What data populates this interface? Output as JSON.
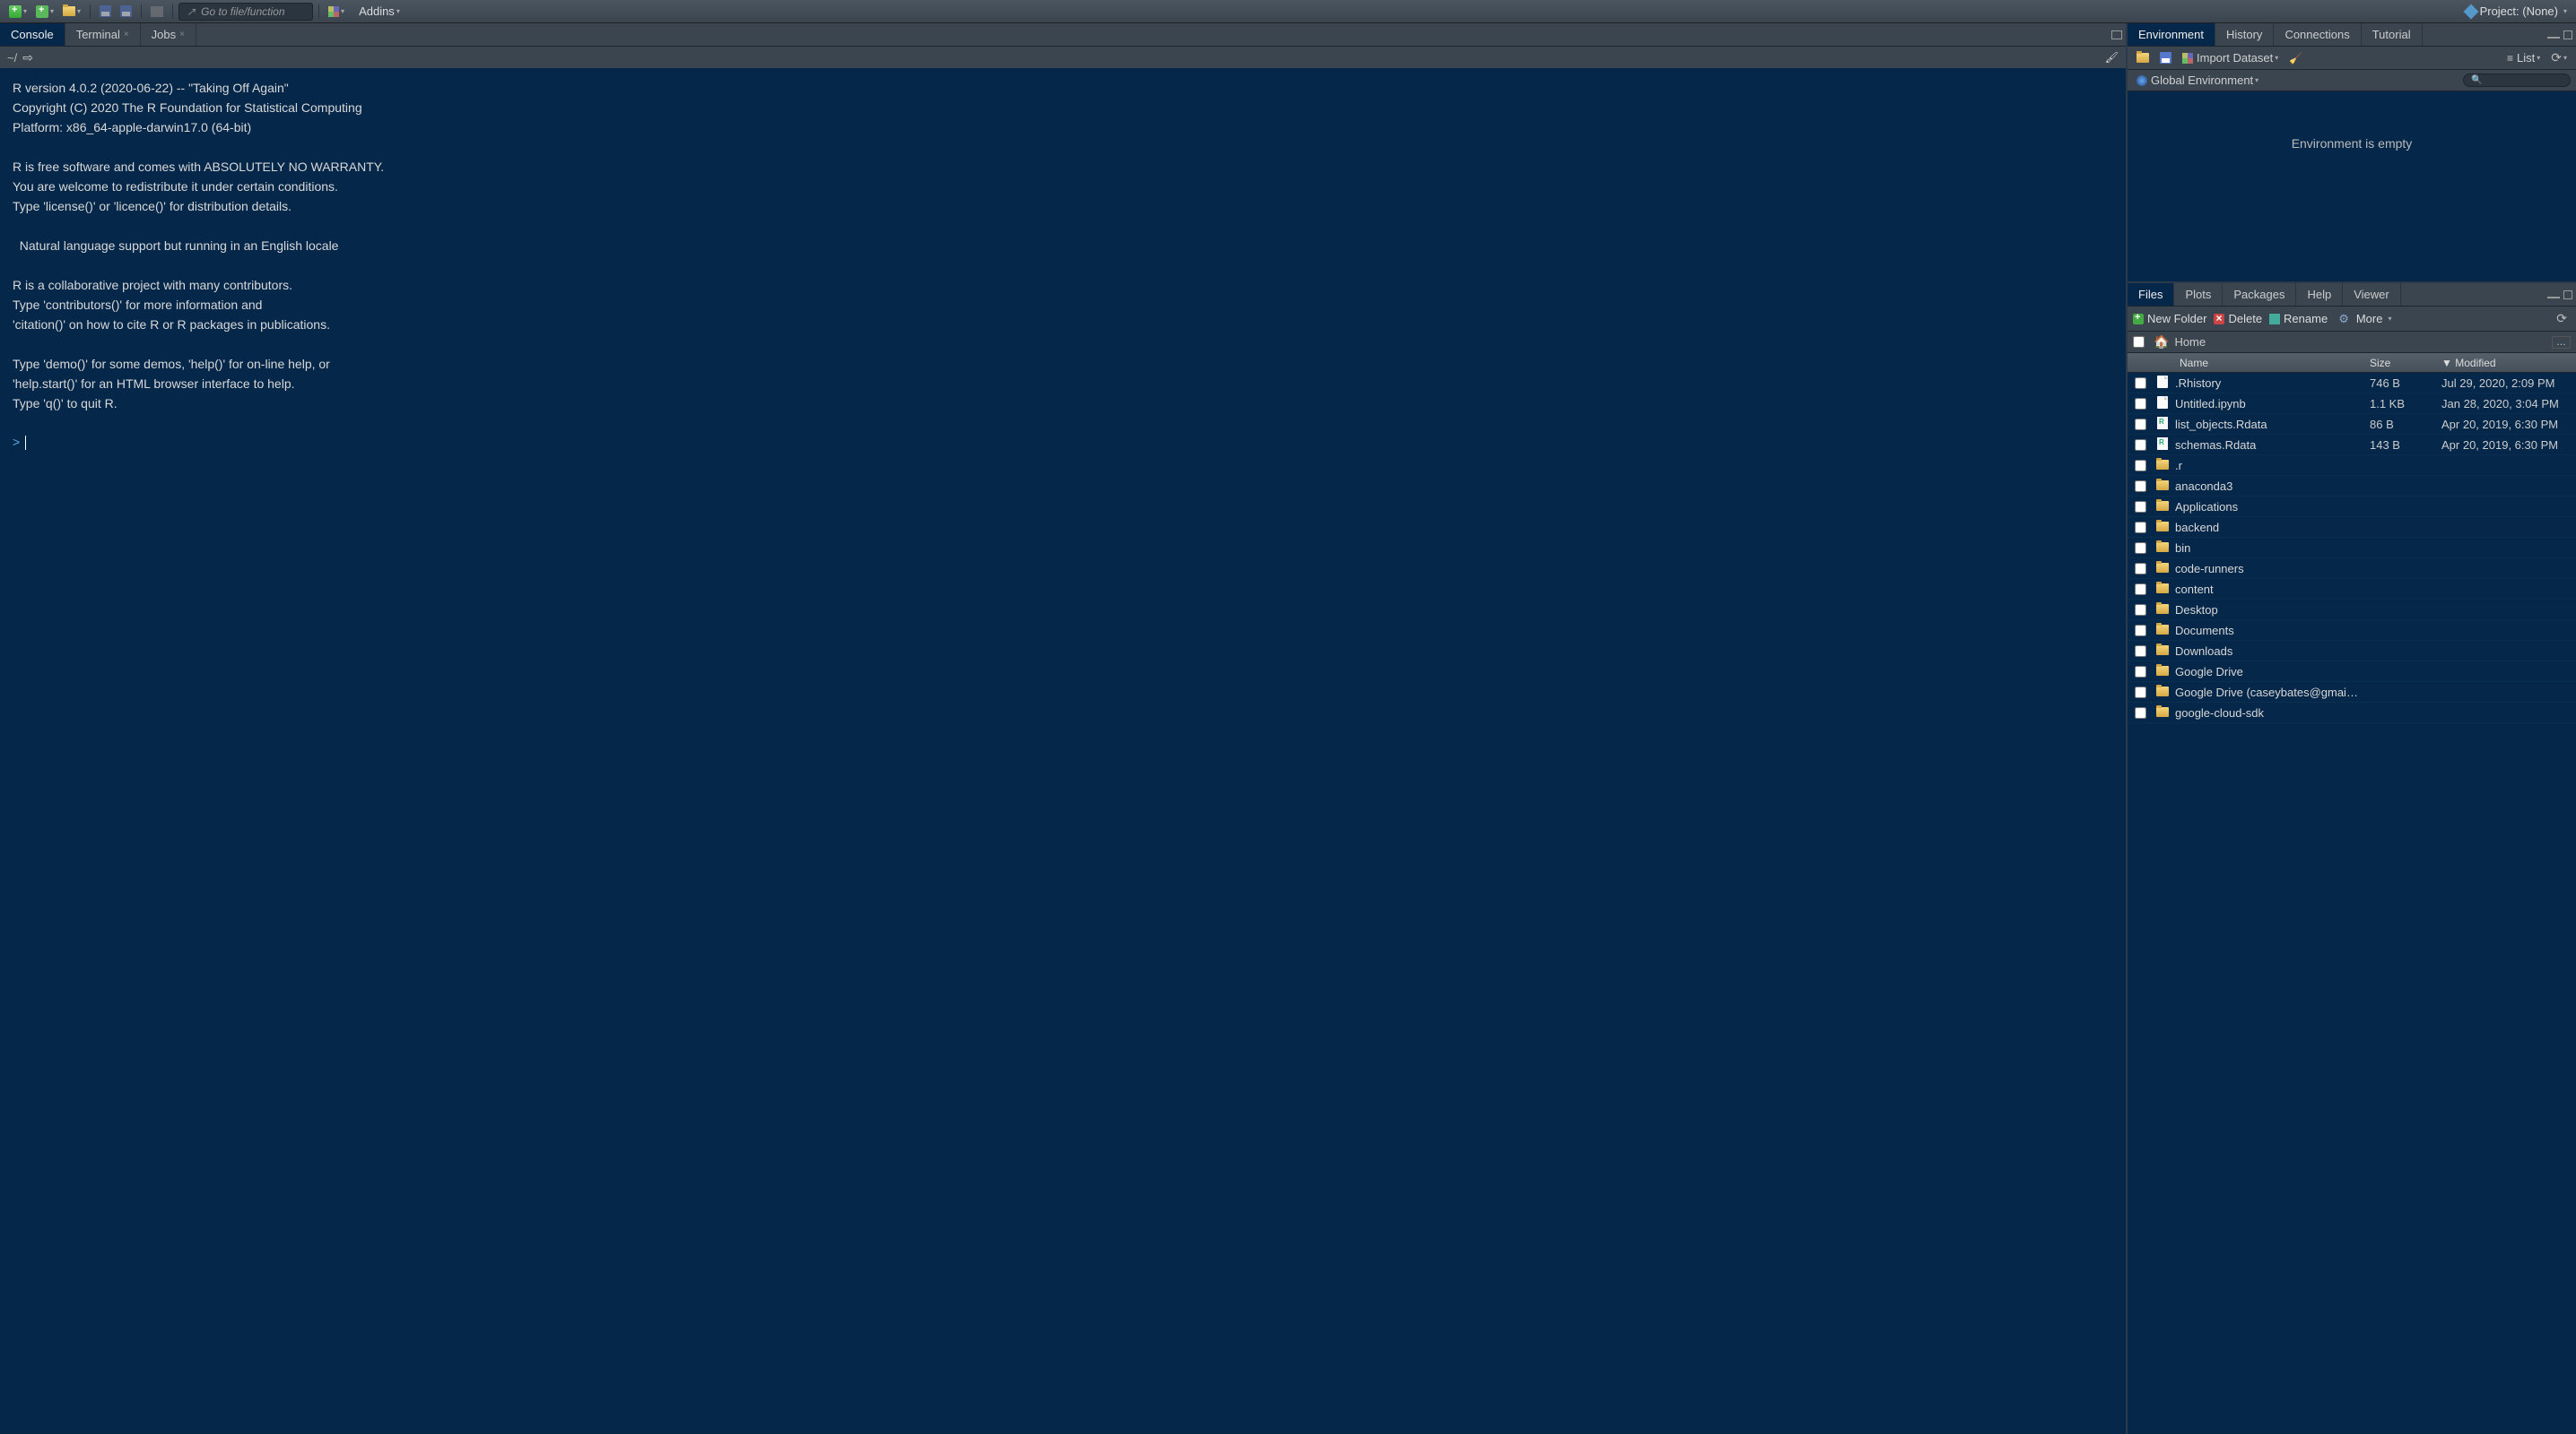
{
  "toolbar": {
    "goto_placeholder": "Go to file/function",
    "addins_label": "Addins",
    "project_label": "Project: (None)"
  },
  "console_pane": {
    "tabs": [
      {
        "label": "Console",
        "closable": false,
        "active": true
      },
      {
        "label": "Terminal",
        "closable": true,
        "active": false
      },
      {
        "label": "Jobs",
        "closable": true,
        "active": false
      }
    ],
    "cwd": "~/",
    "output": "R version 4.0.2 (2020-06-22) -- \"Taking Off Again\"\nCopyright (C) 2020 The R Foundation for Statistical Computing\nPlatform: x86_64-apple-darwin17.0 (64-bit)\n\nR is free software and comes with ABSOLUTELY NO WARRANTY.\nYou are welcome to redistribute it under certain conditions.\nType 'license()' or 'licence()' for distribution details.\n\n  Natural language support but running in an English locale\n\nR is a collaborative project with many contributors.\nType 'contributors()' for more information and\n'citation()' on how to cite R or R packages in publications.\n\nType 'demo()' for some demos, 'help()' for on-line help, or\n'help.start()' for an HTML browser interface to help.\nType 'q()' to quit R.\n",
    "prompt": ">"
  },
  "env_pane": {
    "tabs": [
      {
        "label": "Environment",
        "active": true
      },
      {
        "label": "History",
        "active": false
      },
      {
        "label": "Connections",
        "active": false
      },
      {
        "label": "Tutorial",
        "active": false
      }
    ],
    "import_label": "Import Dataset",
    "list_label": "List",
    "scope_label": "Global Environment",
    "empty_label": "Environment is empty"
  },
  "files_pane": {
    "tabs": [
      {
        "label": "Files",
        "active": true
      },
      {
        "label": "Plots",
        "active": false
      },
      {
        "label": "Packages",
        "active": false
      },
      {
        "label": "Help",
        "active": false
      },
      {
        "label": "Viewer",
        "active": false
      }
    ],
    "new_folder_label": "New Folder",
    "delete_label": "Delete",
    "rename_label": "Rename",
    "more_label": "More",
    "path_label": "Home",
    "headers": {
      "name": "Name",
      "size": "Size",
      "modified": "Modified"
    },
    "rows": [
      {
        "name": ".Rhistory",
        "type": "doc",
        "size": "746 B",
        "modified": "Jul 29, 2020, 2:09 PM"
      },
      {
        "name": "Untitled.ipynb",
        "type": "doc",
        "size": "1.1 KB",
        "modified": "Jan 28, 2020, 3:04 PM"
      },
      {
        "name": "list_objects.Rdata",
        "type": "rdata",
        "size": "86 B",
        "modified": "Apr 20, 2019, 6:30 PM"
      },
      {
        "name": "schemas.Rdata",
        "type": "rdata",
        "size": "143 B",
        "modified": "Apr 20, 2019, 6:30 PM"
      },
      {
        "name": ".r",
        "type": "folder",
        "size": "",
        "modified": ""
      },
      {
        "name": "anaconda3",
        "type": "folder",
        "size": "",
        "modified": ""
      },
      {
        "name": "Applications",
        "type": "folder",
        "size": "",
        "modified": ""
      },
      {
        "name": "backend",
        "type": "folder",
        "size": "",
        "modified": ""
      },
      {
        "name": "bin",
        "type": "folder",
        "size": "",
        "modified": ""
      },
      {
        "name": "code-runners",
        "type": "folder",
        "size": "",
        "modified": ""
      },
      {
        "name": "content",
        "type": "folder",
        "size": "",
        "modified": ""
      },
      {
        "name": "Desktop",
        "type": "folder",
        "size": "",
        "modified": ""
      },
      {
        "name": "Documents",
        "type": "folder",
        "size": "",
        "modified": ""
      },
      {
        "name": "Downloads",
        "type": "folder",
        "size": "",
        "modified": ""
      },
      {
        "name": "Google Drive",
        "type": "folder",
        "size": "",
        "modified": ""
      },
      {
        "name": "Google Drive (caseybates@gmai…",
        "type": "folder",
        "size": "",
        "modified": ""
      },
      {
        "name": "google-cloud-sdk",
        "type": "folder",
        "size": "",
        "modified": ""
      }
    ]
  }
}
